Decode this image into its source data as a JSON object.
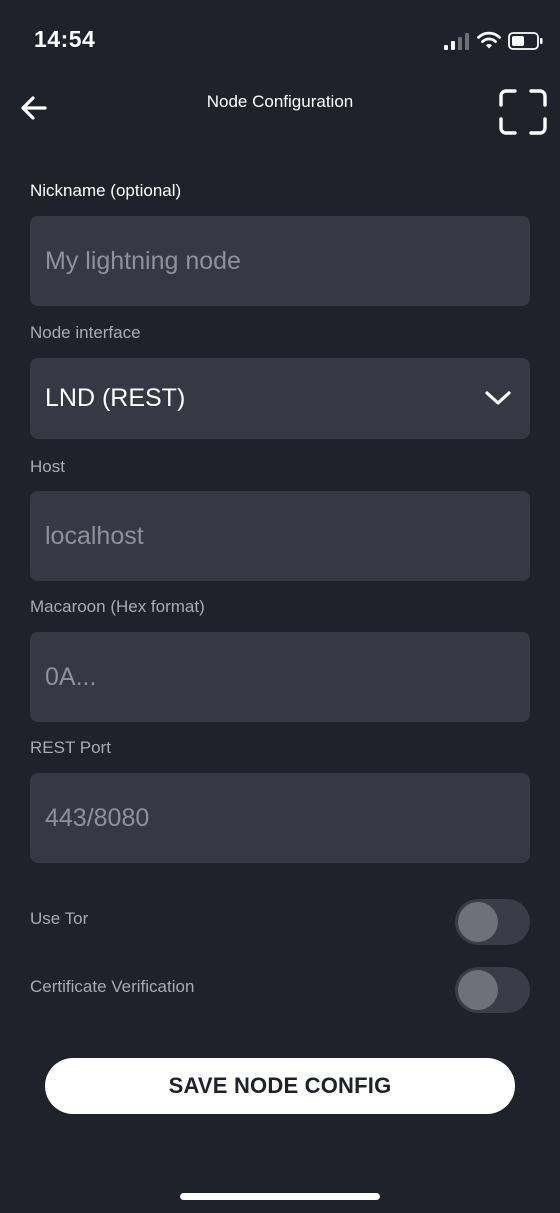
{
  "status_bar": {
    "time": "14:54"
  },
  "header": {
    "title": "Node Configuration",
    "back_icon": "arrow-left-icon",
    "scan_icon": "scan-frame-icon"
  },
  "form": {
    "nickname": {
      "label": "Nickname (optional)",
      "placeholder": "My lightning node",
      "value": ""
    },
    "node_interface": {
      "label": "Node interface",
      "selected": "LND (REST)"
    },
    "host": {
      "label": "Host",
      "placeholder": "localhost",
      "value": ""
    },
    "macaroon": {
      "label": "Macaroon (Hex format)",
      "placeholder": "0A...",
      "value": ""
    },
    "rest_port": {
      "label": "REST Port",
      "placeholder": "443/8080",
      "value": ""
    },
    "use_tor": {
      "label": "Use Tor",
      "enabled": false
    },
    "certificate_verification": {
      "label": "Certificate Verification",
      "enabled": false
    }
  },
  "actions": {
    "save_label": "SAVE NODE CONFIG"
  },
  "colors": {
    "background": "#1f222b",
    "field_background": "#363843",
    "label": "#a9abb2",
    "placeholder": "#8f919a",
    "toggle_track": "#3a3c47",
    "toggle_knob": "#6f7079",
    "button_background": "#ffffff"
  }
}
